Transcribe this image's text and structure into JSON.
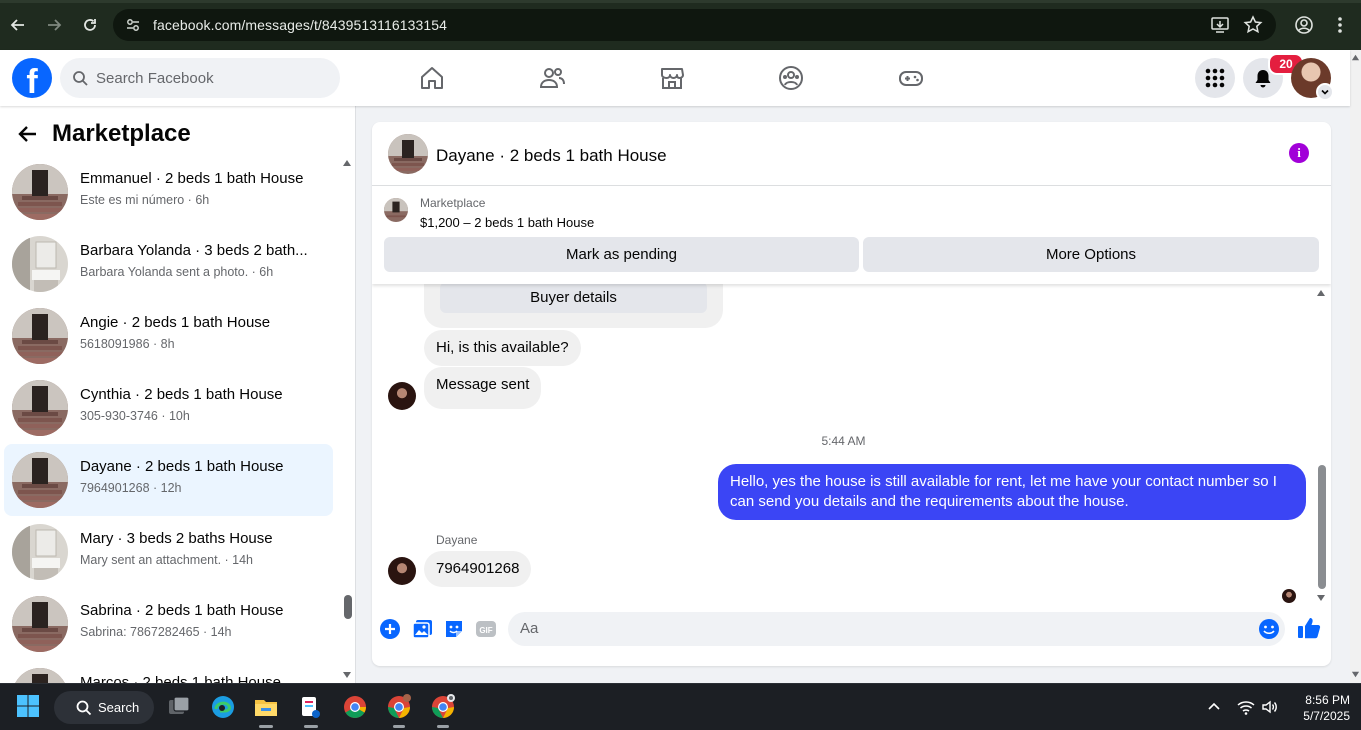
{
  "browser": {
    "url": "facebook.com/messages/t/8439513116133154"
  },
  "header": {
    "search_placeholder": "Search Facebook",
    "notification_count": "20"
  },
  "sidebar": {
    "title": "Marketplace",
    "conversations": [
      {
        "name": "Emmanuel · 2 beds 1 bath House",
        "sub": "Este es mi número · 6h",
        "thumb": "door",
        "active": false
      },
      {
        "name": "Barbara Yolanda · 3 beds 2 bath...",
        "sub": "Barbara Yolanda sent a photo. · 6h",
        "thumb": "bath",
        "active": false
      },
      {
        "name": "Angie · 2 beds 1 bath House",
        "sub": "5618091986 · 8h",
        "thumb": "door",
        "active": false
      },
      {
        "name": "Cynthia · 2 beds 1 bath House",
        "sub": "305-930-3746 · 10h",
        "thumb": "door",
        "active": false
      },
      {
        "name": "Dayane · 2 beds 1 bath House",
        "sub": "7964901268 · 12h",
        "thumb": "door",
        "active": true
      },
      {
        "name": "Mary · 3 beds 2 baths House",
        "sub": "Mary sent an attachment. · 14h",
        "thumb": "bath",
        "active": false
      },
      {
        "name": "Sabrina · 2 beds 1 bath House",
        "sub": "Sabrina: 7867282465 · 14h",
        "thumb": "door",
        "active": false
      },
      {
        "name": "Marcos · 2 beds 1 bath House",
        "sub": "",
        "thumb": "door",
        "active": false
      }
    ]
  },
  "chat": {
    "title": "Dayane · 2 beds 1 bath House",
    "marketplace_label": "Marketplace",
    "listing": "$1,200 – 2 beds 1 bath House",
    "mark_pending": "Mark as pending",
    "more_options": "More Options",
    "buyer_details": "Buyer details",
    "msg1": "Hi, is this available?",
    "msg2": "Message sent",
    "timestamp": "5:44 AM",
    "msg_out": "Hello, yes the house is still available for rent, let me have your contact number so I can send you details and the requirements about the house.",
    "sender_name": "Dayane",
    "msg3": "7964901268",
    "composer_placeholder": "Aa"
  },
  "taskbar": {
    "search_label": "Search",
    "time": "8:56 PM",
    "date": "5/7/2025"
  },
  "colors": {
    "fb_blue": "#0866ff",
    "outgoing_bubble": "#3b45f5",
    "active_conversation": "#ebf5ff",
    "info_purple": "#a100d8"
  }
}
